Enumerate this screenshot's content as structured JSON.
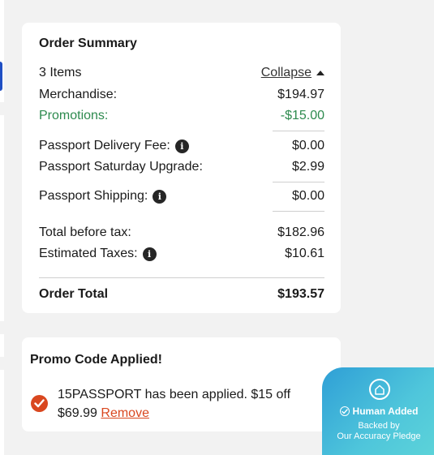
{
  "order_summary": {
    "title": "Order Summary",
    "items_count": "3 Items",
    "collapse_label": "Collapse",
    "merchandise_label": "Merchandise:",
    "merchandise_value": "$194.97",
    "promotions_label": "Promotions:",
    "promotions_value": "-$15.00",
    "delivery_fee_label": "Passport Delivery Fee:",
    "delivery_fee_value": "$0.00",
    "saturday_upgrade_label": "Passport Saturday Upgrade:",
    "saturday_upgrade_value": "$2.99",
    "shipping_label": "Passport Shipping:",
    "shipping_value": "$0.00",
    "total_before_tax_label": "Total before tax:",
    "total_before_tax_value": "$182.96",
    "estimated_taxes_label": "Estimated Taxes:",
    "estimated_taxes_value": "$10.61",
    "order_total_label": "Order Total",
    "order_total_value": "$193.57",
    "info_glyph": "i"
  },
  "promo": {
    "title": "Promo Code Applied!",
    "message": "15PASSPORT has been applied. $15 off $69.99",
    "remove_label": "Remove"
  },
  "badge": {
    "title": "Human Added",
    "line1": "Backed by",
    "line2": "Our Accuracy Pledge"
  },
  "colors": {
    "promotion_green": "#2d8a4e",
    "accent_orange": "#d9471f",
    "badge_teal": "#4fc6db"
  }
}
